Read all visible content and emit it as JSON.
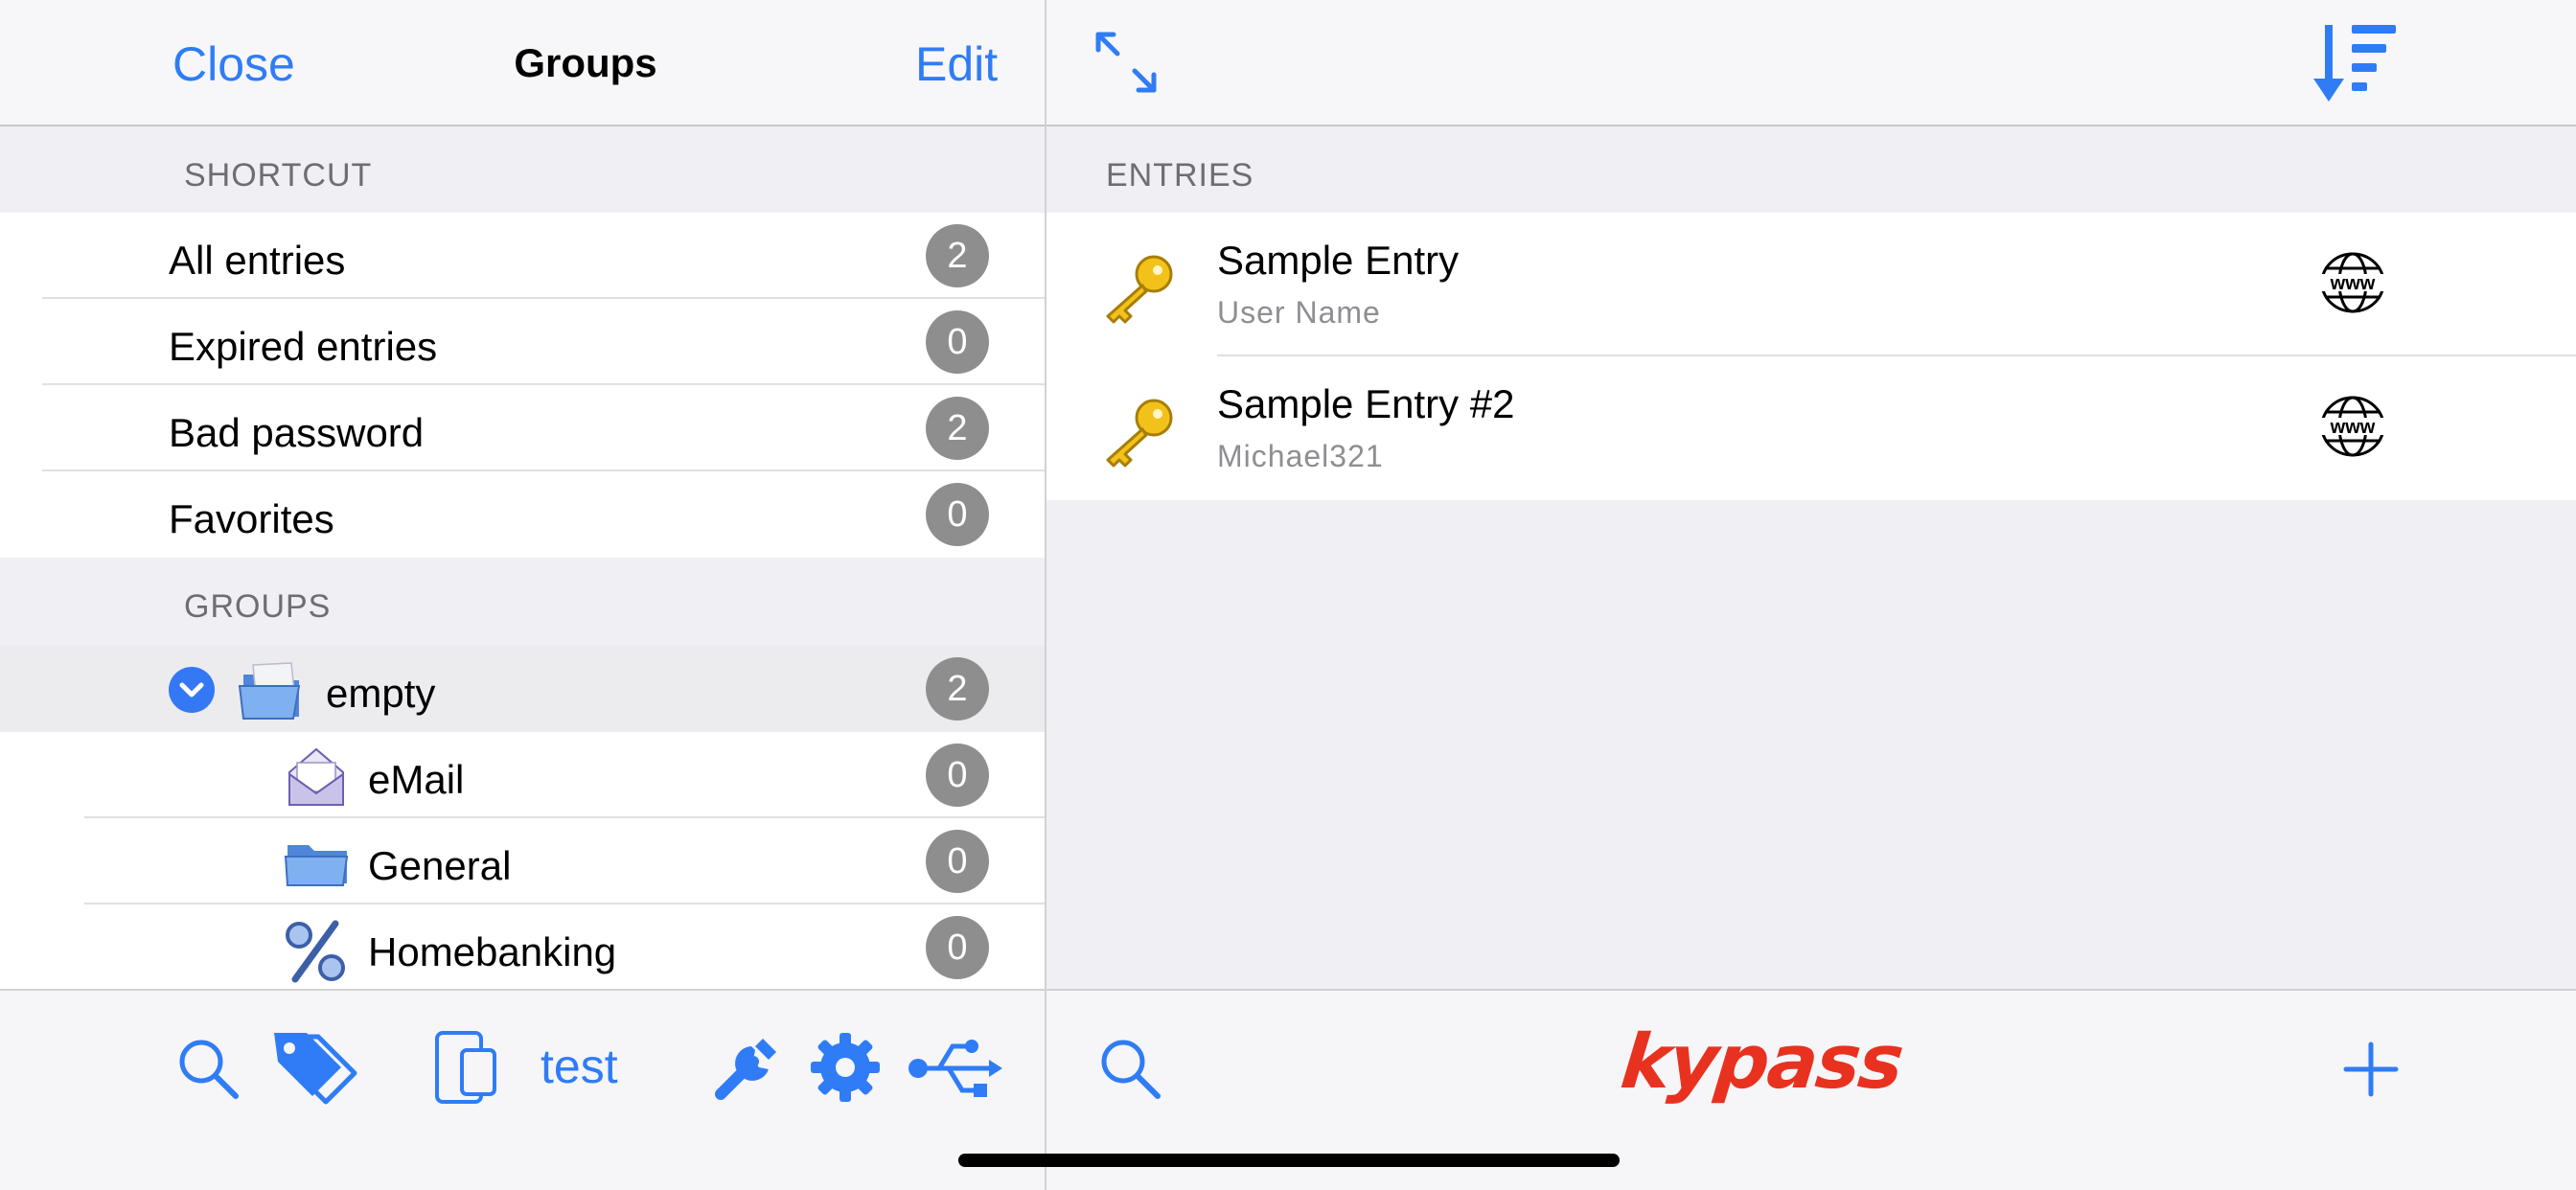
{
  "left_nav": {
    "close_label": "Close",
    "title": "Groups",
    "edit_label": "Edit"
  },
  "shortcut_section": {
    "header": "SHORTCUT",
    "items": [
      {
        "label": "All entries",
        "count": "2"
      },
      {
        "label": "Expired entries",
        "count": "0"
      },
      {
        "label": "Bad password",
        "count": "2"
      },
      {
        "label": "Favorites",
        "count": "0"
      }
    ]
  },
  "groups_section": {
    "header": "GROUPS",
    "root": {
      "label": "empty",
      "count": "2",
      "icon": "folder-open-icon"
    },
    "children": [
      {
        "label": "eMail",
        "count": "0",
        "icon": "envelope-icon"
      },
      {
        "label": "General",
        "count": "0",
        "icon": "folder-icon"
      },
      {
        "label": "Homebanking",
        "count": "0",
        "icon": "percent-icon"
      }
    ]
  },
  "left_toolbar": {
    "device_label": "test",
    "icons": [
      "search-icon",
      "tags-icon",
      "device-icon",
      "wrench-icon",
      "gear-icon",
      "usb-icon"
    ]
  },
  "right_nav": {
    "icons": [
      "expand-icon",
      "sort-icon"
    ]
  },
  "entries": {
    "header": "ENTRIES",
    "items": [
      {
        "title": "Sample Entry",
        "subtitle": "User Name"
      },
      {
        "title": "Sample Entry #2",
        "subtitle": "Michael321"
      }
    ]
  },
  "right_toolbar": {
    "logo_text": "kypass",
    "icons": [
      "search-icon",
      "add-icon"
    ]
  },
  "colors": {
    "accent": "#2f7cf6",
    "badge": "#8e8e8e",
    "logo": "#e8321f",
    "background": "#efeff4"
  }
}
